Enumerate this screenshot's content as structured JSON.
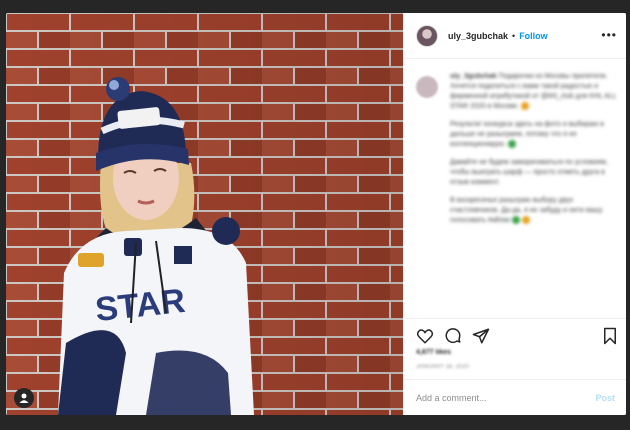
{
  "post": {
    "username": "uly_3gubchak",
    "separator": "•",
    "follow_label": "Follow",
    "more_label": "•••"
  },
  "caption": {
    "username": "uly_3gubchak",
    "paragraphs": [
      "Подарочки из Москвы прилетели. Хочется поделиться с вами такой радостью и фирменной атрибутикой от @khl_club для KHL ALL STAR 2020 в Москве.",
      "Результат конкурса здесь на фото и выбираю в дальше не разыграем, потому что я ее коллекционирую.",
      "Давайте не будем заморачиваться по условиям, чтобы выиграть шарф — просто отметь друга в отзыв коммент.",
      "В воскресенье разыграю выбору двух счастливчиков. Да-да, я не забуду и нити вашу голосовать #allstar"
    ]
  },
  "likes_text": "4,677 likes",
  "date_text": "JANUARY 18, 2020",
  "comment": {
    "placeholder": "Add a comment...",
    "post_label": "Post"
  },
  "colors": {
    "accent": "#0095f6",
    "post_disabled": "#b2dffc",
    "brick": "#8a3a2a"
  },
  "icons": [
    "heart-icon",
    "comment-icon",
    "share-icon",
    "bookmark-icon",
    "more-icon",
    "user-icon"
  ]
}
